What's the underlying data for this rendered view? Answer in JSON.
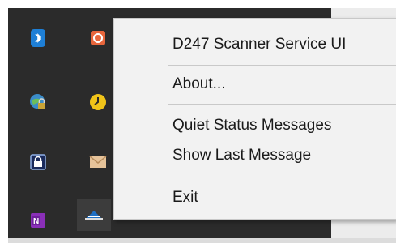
{
  "tray": {
    "icons": [
      {
        "name": "bluetooth-icon"
      },
      {
        "name": "shield-app-icon"
      },
      {
        "name": "network-sharing-icon"
      },
      {
        "name": "clock-app-icon"
      },
      {
        "name": "lock-icon"
      },
      {
        "name": "mail-icon"
      },
      {
        "name": "onenote-icon"
      },
      {
        "name": "scanner-service-icon"
      }
    ]
  },
  "context_menu": {
    "items": [
      {
        "label": "D247 Scanner Service UI"
      },
      {
        "label": "About..."
      },
      {
        "label": "Quiet Status Messages"
      },
      {
        "label": "Show Last Message"
      },
      {
        "label": "Exit"
      }
    ]
  },
  "colors": {
    "tray_background": "#2b2b2b",
    "menu_background": "#f2f2f2",
    "separator": "#c9c9c9"
  }
}
